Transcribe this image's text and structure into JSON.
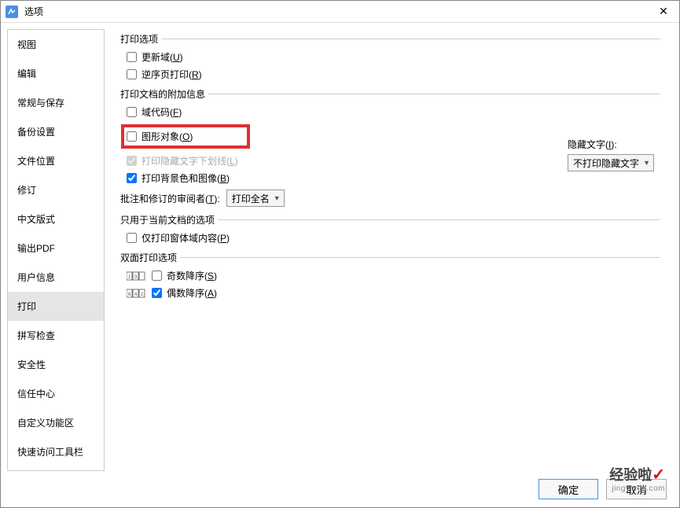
{
  "window": {
    "title": "选项",
    "close": "✕"
  },
  "sidebar": {
    "items": [
      {
        "label": "视图"
      },
      {
        "label": "编辑"
      },
      {
        "label": "常规与保存"
      },
      {
        "label": "备份设置"
      },
      {
        "label": "文件位置"
      },
      {
        "label": "修订"
      },
      {
        "label": "中文版式"
      },
      {
        "label": "输出PDF"
      },
      {
        "label": "用户信息"
      },
      {
        "label": "打印",
        "selected": true
      },
      {
        "label": "拼写检查"
      },
      {
        "label": "安全性"
      },
      {
        "label": "信任中心"
      },
      {
        "label": "自定义功能区"
      },
      {
        "label": "快速访问工具栏"
      }
    ]
  },
  "groups": {
    "print_options": {
      "title": "打印选项",
      "update_fields_pre": "更新域(",
      "update_fields_key": "U",
      "update_fields_post": ")",
      "reverse_print_pre": "逆序页打印(",
      "reverse_print_key": "R",
      "reverse_print_post": ")"
    },
    "doc_info": {
      "title": "打印文档的附加信息",
      "field_codes_pre": "域代码(",
      "field_codes_key": "F",
      "field_codes_post": ")",
      "graphics_pre": "图形对象(",
      "graphics_key": "O",
      "graphics_post": ")",
      "hidden_underline_pre": "打印隐藏文字下划线(",
      "hidden_underline_key": "L",
      "hidden_underline_post": ")",
      "background_pre": "打印背景色和图像(",
      "background_key": "B",
      "background_post": ")",
      "reviewer_label_pre": "批注和修订的审阅者(",
      "reviewer_label_key": "T",
      "reviewer_label_post": "):",
      "reviewer_value": "打印全名",
      "hidden_text_label_pre": "隐藏文字(",
      "hidden_text_label_key": "I",
      "hidden_text_label_post": "):",
      "hidden_text_value": "不打印隐藏文字"
    },
    "current_doc": {
      "title": "只用于当前文档的选项",
      "form_fields_pre": "仅打印窗体域内容(",
      "form_fields_key": "P",
      "form_fields_post": ")"
    },
    "duplex": {
      "title": "双面打印选项",
      "odd_desc_pre": "奇数降序(",
      "odd_desc_key": "S",
      "odd_desc_post": ")",
      "even_desc_pre": "偶数降序(",
      "even_desc_key": "A",
      "even_desc_post": ")"
    }
  },
  "footer": {
    "ok": "确定",
    "cancel": "取消"
  },
  "watermark": {
    "top": "经验啦",
    "bottom": "jingyanla.com",
    "check": "✓"
  }
}
